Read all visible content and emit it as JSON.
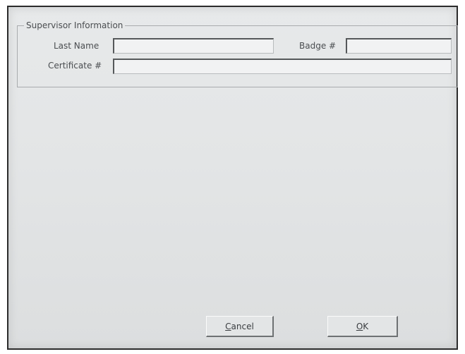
{
  "dialog": {
    "group_title": "Supervisor Information",
    "fields": {
      "last_name": {
        "label": "Last Name",
        "value": ""
      },
      "badge": {
        "label": "Badge #",
        "value": ""
      },
      "certificate": {
        "label": "Certificate #",
        "value": ""
      }
    },
    "buttons": {
      "cancel": {
        "accel": "C",
        "rest": "ancel"
      },
      "ok": {
        "accel": "O",
        "rest": "K"
      }
    }
  }
}
